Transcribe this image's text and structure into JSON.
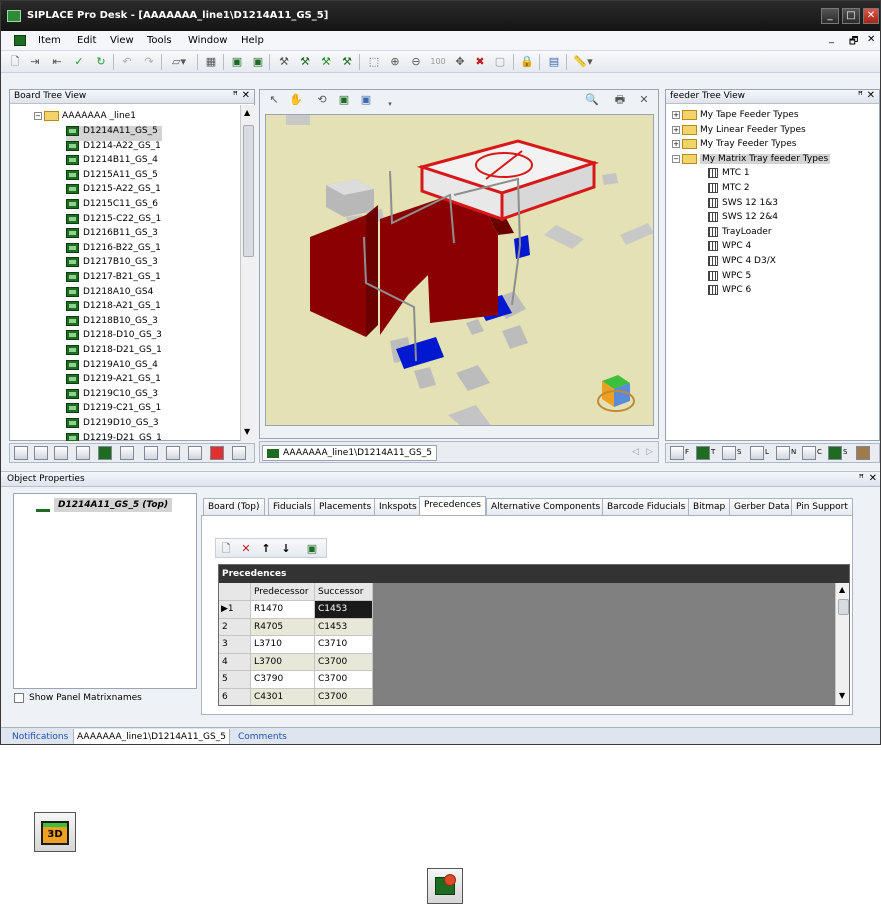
{
  "window": {
    "title": "SIPLACE Pro Desk - [AAAAAAA_line1\\D1214A11_GS_5]",
    "minimize_glyph": "_",
    "maximize_glyph": "□",
    "close_glyph": "✕"
  },
  "menu": [
    "Item",
    "Edit",
    "View",
    "Tools",
    "Window",
    "Help"
  ],
  "mdi_controls": [
    "_",
    "🗗",
    "✕"
  ],
  "board_tree": {
    "title": "Board Tree View",
    "root": "AAAAAAA _line1",
    "items": [
      "D1214A11_GS_5",
      "D1214-A22_GS_1",
      "D1214B11_GS_4",
      "D1215A11_GS_5",
      "D1215-A22_GS_1",
      "D1215C11_GS_6",
      "D1215-C22_GS_1",
      "D1216B11_GS_3",
      "D1216-B22_GS_1",
      "D1217B10_GS_3",
      "D1217-B21_GS_1",
      "D1218A10_GS4",
      "D1218-A21_GS_1",
      "D1218B10_GS_3",
      "D1218-D10_GS_3",
      "D1218-D21_GS_1",
      "D1219A10_GS_4",
      "D1219-A21_GS_1",
      "D1219C10_GS_3",
      "D1219-C21_GS_1",
      "D1219D10_GS_3",
      "D1219-D21_GS_1"
    ]
  },
  "viewer": {
    "tab_label": "AAAAAAA_line1\\D1214A11_GS_5"
  },
  "feeder_tree": {
    "title": "feeder Tree View",
    "folders": [
      "My Tape Feeder Types",
      "My Linear Feeder Types",
      "My Tray Feeder Types",
      "My Matrix Tray feeder Types"
    ],
    "items": [
      "MTC 1",
      "MTC 2",
      "SWS 12 1&3",
      "SWS 12 2&4",
      "TrayLoader",
      "WPC 4",
      "WPC 4 D3/X",
      "WPC 5",
      "WPC 6"
    ]
  },
  "object_properties": {
    "title": "Object Properties",
    "selected_object": "D1214A11_GS_5 (Top)",
    "show_panel_matrix_label": "Show Panel Matrixnames",
    "tabs": [
      "Board (Top)",
      "Fiducials",
      "Placements",
      "Inkspots",
      "Precedences",
      "Alternative Components",
      "Barcode Fiducials",
      "Bitmap",
      "Gerber Data",
      "Pin Support"
    ],
    "active_tab": "Precedences",
    "grid_title": "Precedences",
    "columns": [
      "Predecessor",
      "Successor"
    ],
    "rows": [
      {
        "num": "1",
        "pred": "R1470",
        "succ": "C1453"
      },
      {
        "num": "2",
        "pred": "R4705",
        "succ": "C1453"
      },
      {
        "num": "3",
        "pred": "L3710",
        "succ": "C3710"
      },
      {
        "num": "4",
        "pred": "L3700",
        "succ": "C3700"
      },
      {
        "num": "5",
        "pred": "C3790",
        "succ": "C3700"
      },
      {
        "num": "6",
        "pred": "C4301",
        "succ": "C3700"
      }
    ]
  },
  "bottom_tabs": [
    "Notifications",
    "AAAAAAA_line1\\D1214A11_GS_5",
    "Comments"
  ],
  "feeder_strip_letters": [
    "F",
    "T",
    "S",
    "L",
    "N",
    "C",
    "S"
  ],
  "legend_icons": {
    "view3d_text": "3D"
  },
  "colors": {
    "component_red": "#8b0000",
    "pad_blue": "#0018d0",
    "board_surface": "#e4e2b4",
    "titlebar": "#1c1c1c"
  }
}
